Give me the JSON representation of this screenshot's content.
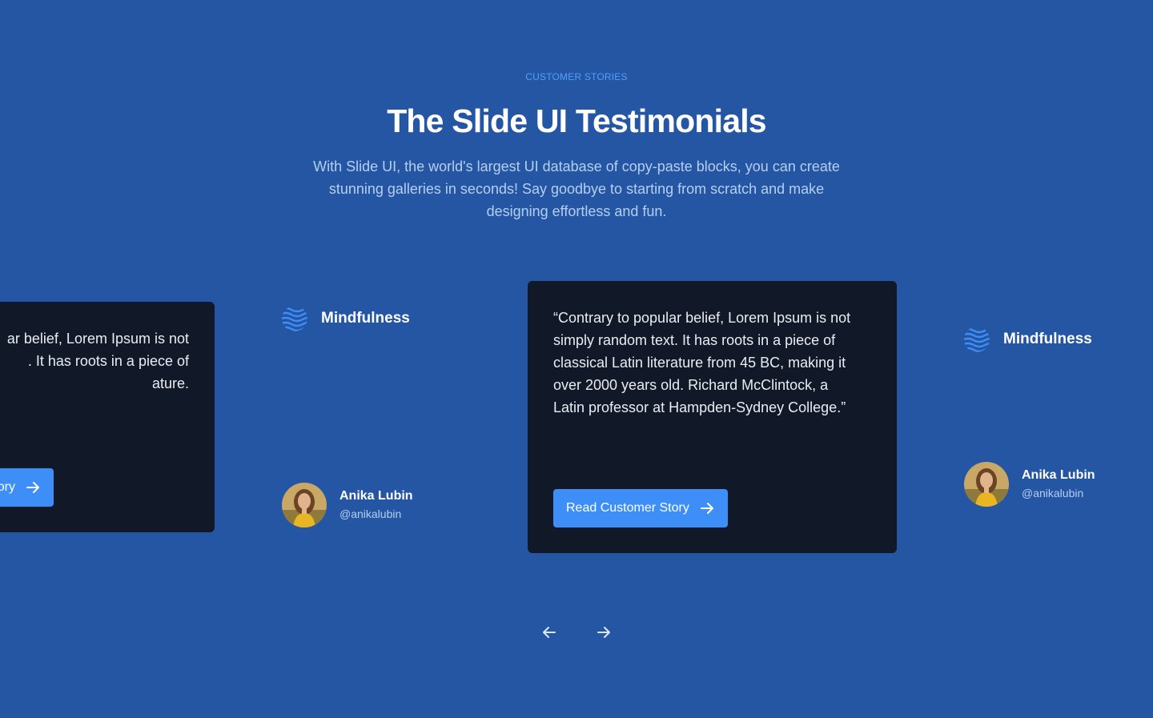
{
  "section": {
    "eyebrow": "CUSTOMER STORIES",
    "title": "The Slide UI Testimonials",
    "subtitle": "With Slide UI, the world's largest UI database of copy-paste blocks, you can create stunning galleries in seconds! Say goodbye to starting from scratch and make designing effortless and fun."
  },
  "colors": {
    "background": "#2556a3",
    "card": "#111827",
    "accent": "#3d8ef7",
    "eyebrow": "#4fa0ff",
    "muted_text": "#b4cff2"
  },
  "slides": {
    "left_partial": {
      "quote": "ar belief, Lorem Ipsum is not\n. It has roots in a piece of\nature.",
      "cta_label": "ory",
      "cta_icon": "arrow-right-icon"
    },
    "brand_left": {
      "logo_icon": "waves-logo-icon",
      "name": "Mindfulness",
      "author_name": "Anika Lubin",
      "author_handle": "@anikalubin"
    },
    "center": {
      "quote": "“Contrary to popular belief, Lorem Ipsum is not\nsimply random text. It has roots in a piece of\nclassical Latin literature from 45 BC, making it\nover 2000 years old. Richard McClintock, a\nLatin professor at Hampden-Sydney College.”",
      "cta_label": "Read Customer Story",
      "cta_icon": "arrow-right-icon"
    },
    "brand_right": {
      "logo_icon": "waves-logo-icon",
      "name": "Mindfulness",
      "author_name": "Anika Lubin",
      "author_handle": "@anikalubin"
    }
  },
  "navigation": {
    "prev_icon": "arrow-left-icon",
    "next_icon": "arrow-right-icon"
  }
}
